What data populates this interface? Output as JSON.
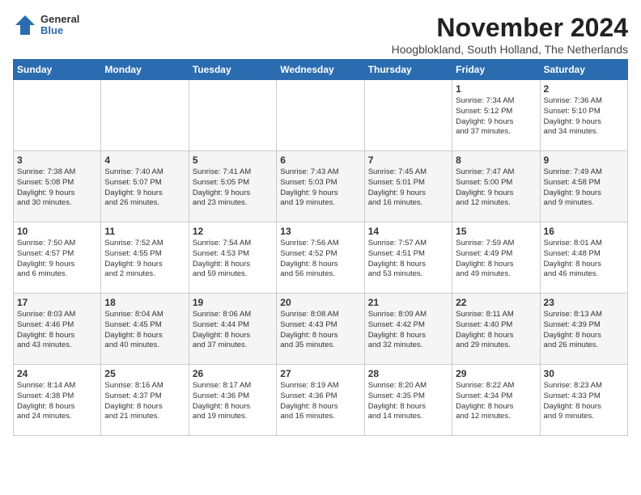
{
  "logo": {
    "general": "General",
    "blue": "Blue"
  },
  "title": {
    "month_year": "November 2024",
    "location": "Hoogblokland, South Holland, The Netherlands"
  },
  "headers": [
    "Sunday",
    "Monday",
    "Tuesday",
    "Wednesday",
    "Thursday",
    "Friday",
    "Saturday"
  ],
  "weeks": [
    [
      {
        "day": "",
        "info": ""
      },
      {
        "day": "",
        "info": ""
      },
      {
        "day": "",
        "info": ""
      },
      {
        "day": "",
        "info": ""
      },
      {
        "day": "",
        "info": ""
      },
      {
        "day": "1",
        "info": "Sunrise: 7:34 AM\nSunset: 5:12 PM\nDaylight: 9 hours\nand 37 minutes."
      },
      {
        "day": "2",
        "info": "Sunrise: 7:36 AM\nSunset: 5:10 PM\nDaylight: 9 hours\nand 34 minutes."
      }
    ],
    [
      {
        "day": "3",
        "info": "Sunrise: 7:38 AM\nSunset: 5:08 PM\nDaylight: 9 hours\nand 30 minutes."
      },
      {
        "day": "4",
        "info": "Sunrise: 7:40 AM\nSunset: 5:07 PM\nDaylight: 9 hours\nand 26 minutes."
      },
      {
        "day": "5",
        "info": "Sunrise: 7:41 AM\nSunset: 5:05 PM\nDaylight: 9 hours\nand 23 minutes."
      },
      {
        "day": "6",
        "info": "Sunrise: 7:43 AM\nSunset: 5:03 PM\nDaylight: 9 hours\nand 19 minutes."
      },
      {
        "day": "7",
        "info": "Sunrise: 7:45 AM\nSunset: 5:01 PM\nDaylight: 9 hours\nand 16 minutes."
      },
      {
        "day": "8",
        "info": "Sunrise: 7:47 AM\nSunset: 5:00 PM\nDaylight: 9 hours\nand 12 minutes."
      },
      {
        "day": "9",
        "info": "Sunrise: 7:49 AM\nSunset: 4:58 PM\nDaylight: 9 hours\nand 9 minutes."
      }
    ],
    [
      {
        "day": "10",
        "info": "Sunrise: 7:50 AM\nSunset: 4:57 PM\nDaylight: 9 hours\nand 6 minutes."
      },
      {
        "day": "11",
        "info": "Sunrise: 7:52 AM\nSunset: 4:55 PM\nDaylight: 9 hours\nand 2 minutes."
      },
      {
        "day": "12",
        "info": "Sunrise: 7:54 AM\nSunset: 4:53 PM\nDaylight: 8 hours\nand 59 minutes."
      },
      {
        "day": "13",
        "info": "Sunrise: 7:56 AM\nSunset: 4:52 PM\nDaylight: 8 hours\nand 56 minutes."
      },
      {
        "day": "14",
        "info": "Sunrise: 7:57 AM\nSunset: 4:51 PM\nDaylight: 8 hours\nand 53 minutes."
      },
      {
        "day": "15",
        "info": "Sunrise: 7:59 AM\nSunset: 4:49 PM\nDaylight: 8 hours\nand 49 minutes."
      },
      {
        "day": "16",
        "info": "Sunrise: 8:01 AM\nSunset: 4:48 PM\nDaylight: 8 hours\nand 46 minutes."
      }
    ],
    [
      {
        "day": "17",
        "info": "Sunrise: 8:03 AM\nSunset: 4:46 PM\nDaylight: 8 hours\nand 43 minutes."
      },
      {
        "day": "18",
        "info": "Sunrise: 8:04 AM\nSunset: 4:45 PM\nDaylight: 8 hours\nand 40 minutes."
      },
      {
        "day": "19",
        "info": "Sunrise: 8:06 AM\nSunset: 4:44 PM\nDaylight: 8 hours\nand 37 minutes."
      },
      {
        "day": "20",
        "info": "Sunrise: 8:08 AM\nSunset: 4:43 PM\nDaylight: 8 hours\nand 35 minutes."
      },
      {
        "day": "21",
        "info": "Sunrise: 8:09 AM\nSunset: 4:42 PM\nDaylight: 8 hours\nand 32 minutes."
      },
      {
        "day": "22",
        "info": "Sunrise: 8:11 AM\nSunset: 4:40 PM\nDaylight: 8 hours\nand 29 minutes."
      },
      {
        "day": "23",
        "info": "Sunrise: 8:13 AM\nSunset: 4:39 PM\nDaylight: 8 hours\nand 26 minutes."
      }
    ],
    [
      {
        "day": "24",
        "info": "Sunrise: 8:14 AM\nSunset: 4:38 PM\nDaylight: 8 hours\nand 24 minutes."
      },
      {
        "day": "25",
        "info": "Sunrise: 8:16 AM\nSunset: 4:37 PM\nDaylight: 8 hours\nand 21 minutes."
      },
      {
        "day": "26",
        "info": "Sunrise: 8:17 AM\nSunset: 4:36 PM\nDaylight: 8 hours\nand 19 minutes."
      },
      {
        "day": "27",
        "info": "Sunrise: 8:19 AM\nSunset: 4:36 PM\nDaylight: 8 hours\nand 16 minutes."
      },
      {
        "day": "28",
        "info": "Sunrise: 8:20 AM\nSunset: 4:35 PM\nDaylight: 8 hours\nand 14 minutes."
      },
      {
        "day": "29",
        "info": "Sunrise: 8:22 AM\nSunset: 4:34 PM\nDaylight: 8 hours\nand 12 minutes."
      },
      {
        "day": "30",
        "info": "Sunrise: 8:23 AM\nSunset: 4:33 PM\nDaylight: 8 hours\nand 9 minutes."
      }
    ]
  ]
}
